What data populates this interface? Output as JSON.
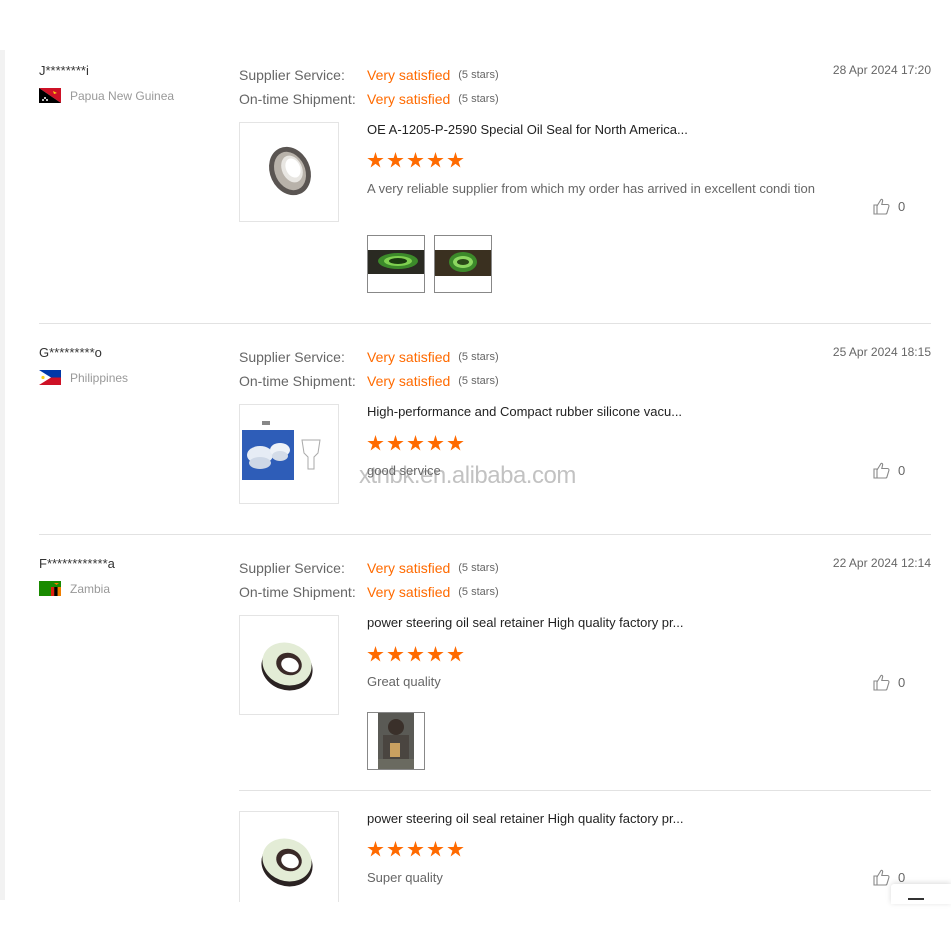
{
  "watermark": "xtnbk.en.alibaba.com",
  "reviews": [
    {
      "reviewer": "J********i",
      "country": "Papua New Guinea",
      "flag": "papua-new-guinea-flag",
      "date": "28 Apr 2024 17:20",
      "supplier_service_label": "Supplier Service:",
      "supplier_service_value": "Very satisfied",
      "supplier_service_stars": "(5 stars)",
      "shipment_label": "On-time Shipment:",
      "shipment_value": "Very satisfied",
      "shipment_stars": "(5 stars)",
      "products": [
        {
          "title": "OE A-1205-P-2590 Special Oil Seal for North America...",
          "rating": 5,
          "comment": "A very reliable supplier from which my order has arrived in excellent condi tion",
          "likes": "0",
          "photo_count": 2
        }
      ]
    },
    {
      "reviewer": "G*********o",
      "country": "Philippines",
      "flag": "philippines-flag",
      "date": "25 Apr 2024 18:15",
      "supplier_service_label": "Supplier Service:",
      "supplier_service_value": "Very satisfied",
      "supplier_service_stars": "(5 stars)",
      "shipment_label": "On-time Shipment:",
      "shipment_value": "Very satisfied",
      "shipment_stars": "(5 stars)",
      "products": [
        {
          "title": "High-performance and Compact rubber silicone vacu...",
          "rating": 5,
          "comment": "good service",
          "likes": "0",
          "photo_count": 0
        }
      ]
    },
    {
      "reviewer": "F************a",
      "country": "Zambia",
      "flag": "zambia-flag",
      "date": "22 Apr 2024 12:14",
      "supplier_service_label": "Supplier Service:",
      "supplier_service_value": "Very satisfied",
      "supplier_service_stars": "(5 stars)",
      "shipment_label": "On-time Shipment:",
      "shipment_value": "Very satisfied",
      "shipment_stars": "(5 stars)",
      "products": [
        {
          "title": "power steering oil seal retainer High quality factory pr...",
          "rating": 5,
          "comment": "Great quality",
          "likes": "0",
          "photo_count": 1
        },
        {
          "title": "power steering oil seal retainer High quality factory pr...",
          "rating": 5,
          "comment": "Super quality",
          "likes": "0",
          "photo_count": 0
        }
      ]
    }
  ],
  "colors": {
    "accent": "#ff6a00",
    "divider": "#e2e2e2",
    "muted": "#999999"
  }
}
